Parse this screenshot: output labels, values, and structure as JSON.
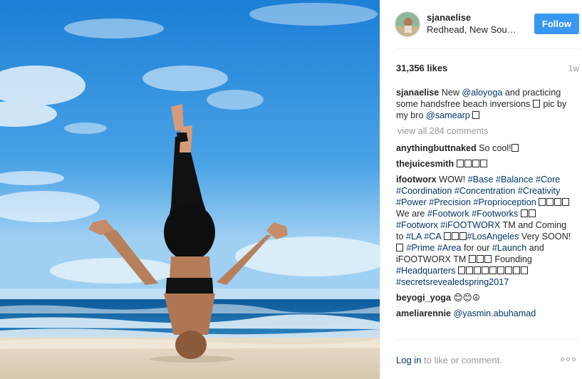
{
  "post": {
    "username": "sjanaelise",
    "location": "Redhead, New South Wales",
    "follow_label": "Follow",
    "likes": "31,356 likes",
    "age": "1w",
    "caption": {
      "user": "sjanaelise",
      "t1": "New ",
      "tag1": "@aloyoga",
      "t2": " and practicing some handsfree beach inversions ",
      "t3": " pic by my bro ",
      "tag2": "@samearp"
    },
    "view_all": "view all 284 comments",
    "comments": {
      "c1_user": "anythingbuttnaked",
      "c1_text": "So cool!",
      "c2_user": "thejuicesmith",
      "c3_user": "ifootworx",
      "c3_t1": "WOW! ",
      "c3_tags_a": [
        "#Base",
        "#Balance",
        "#Core",
        "#Coordination",
        "#Concentration",
        "#Creativity",
        "#Power",
        "#Precision",
        "#Proprioception"
      ],
      "c3_t2": " We are ",
      "c3_tag_footwork": "#Footwork",
      "c3_tag_footworks": "#Footworks",
      "c3_tag_footworx": "#Footworx",
      "c3_tag_ifootworx": "#iFOOTWORX",
      "c3_t3": " TM and Coming to ",
      "c3_tag_la": "#LA",
      "c3_tag_ca": "#CA",
      "c3_tag_losangeles": "#LosAngeles",
      "c3_t4": " Very SOON! ",
      "c3_tag_prime": "#Prime",
      "c3_tag_area": "#Area",
      "c3_t5": " for our ",
      "c3_tag_launch": "#Launch",
      "c3_t6": " and iFOOTWORX TM ",
      "c3_t7": " Founding ",
      "c3_tag_hq": "#Headquarters",
      "c3_tag_secrets": "#secretsrevealedspring2017",
      "c4_user": "beyogi_yoga",
      "c4_text": "😊😊☮",
      "c5_user": "ameliarennie",
      "c5_tag": "@yasmin.abuhamad"
    },
    "footer": {
      "login": "Log in",
      "rest": " to like or comment."
    }
  },
  "icons": {
    "more": "more-options-icon",
    "missing_glyph": "missing-glyph-box"
  },
  "colors": {
    "follow_blue": "#3897f0",
    "link": "#003569",
    "muted": "#999999"
  }
}
